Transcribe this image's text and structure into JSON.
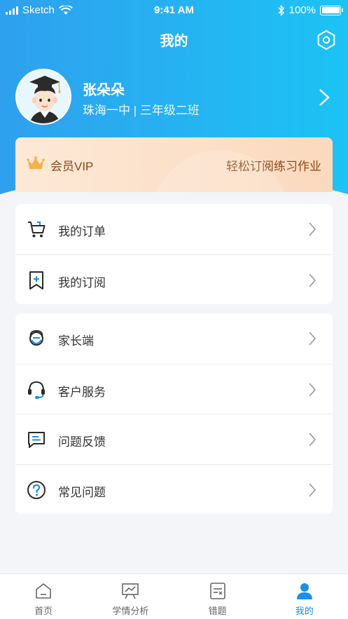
{
  "status_bar": {
    "carrier": "Sketch",
    "time": "9:41 AM",
    "battery": "100%"
  },
  "header": {
    "title": "我的",
    "settings_icon": "settings-hexagon-icon"
  },
  "profile": {
    "name": "张朵朵",
    "school": "珠海一中 | 三年级二班",
    "avatar_icon": "graduate-avatar"
  },
  "vip": {
    "label": "会员VIP",
    "promo": "轻松订阅练习作业",
    "icon": "crown-icon"
  },
  "menu_group_1": [
    {
      "label": "我的订单",
      "icon": "cart-icon"
    },
    {
      "label": "我的订阅",
      "icon": "bookmark-add-icon"
    }
  ],
  "menu_group_2": [
    {
      "label": "家长端",
      "icon": "parent-icon"
    },
    {
      "label": "客户服务",
      "icon": "headset-icon"
    },
    {
      "label": "问题反馈",
      "icon": "message-icon"
    },
    {
      "label": "常见问题",
      "icon": "question-icon"
    }
  ],
  "tab_bar": [
    {
      "label": "首页",
      "icon": "home-icon",
      "active": false
    },
    {
      "label": "学情分析",
      "icon": "analysis-icon",
      "active": false
    },
    {
      "label": "错题",
      "icon": "wrong-questions-icon",
      "active": false
    },
    {
      "label": "我的",
      "icon": "user-icon",
      "active": true
    }
  ],
  "colors": {
    "header_start": "#2fa0ee",
    "header_end": "#1cc3f5",
    "tab_active": "#1b8fe6",
    "vip_text": "#8a4b1b",
    "menu_icon_accent": "#1b8fe6"
  }
}
